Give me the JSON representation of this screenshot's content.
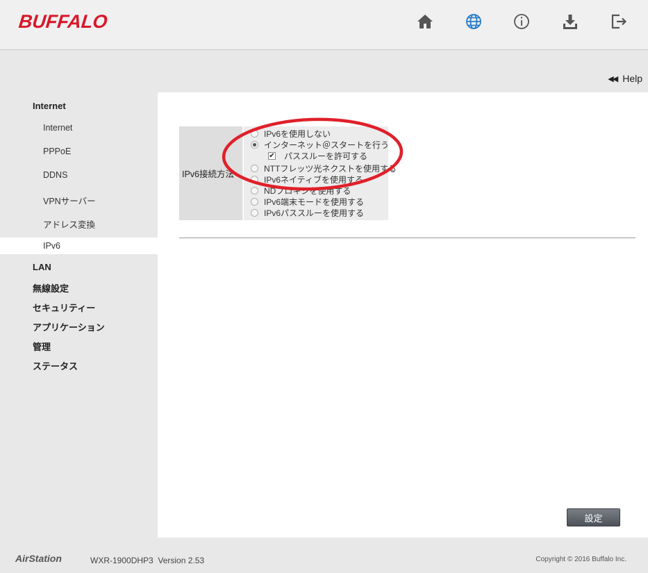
{
  "header": {
    "brand": "BUFFALO",
    "brand_color": "#d7182a",
    "icons": [
      "home-icon",
      "globe-icon",
      "info-icon",
      "download-icon",
      "logout-icon"
    ],
    "active_icon_color": "#2a7cc7"
  },
  "help": {
    "label": "Help"
  },
  "sidebar": {
    "internet": "Internet",
    "internet_sub": "Internet",
    "pppoe": "PPPoE",
    "ddns": "DDNS",
    "vpn": "VPNサーバー",
    "nat": "アドレス変換",
    "ipv6": "IPv6",
    "lan": "LAN",
    "wireless": "無線設定",
    "security": "セキュリティー",
    "application": "アプリケーション",
    "admin": "管理",
    "status": "ステータス"
  },
  "form": {
    "label": "IPv6接続方法",
    "options": [
      {
        "label": "IPv6を使用しない",
        "selected": false
      },
      {
        "label": "インターネット＠スタートを行う",
        "selected": true
      },
      {
        "label": "パススルーを許可する",
        "checked": true
      },
      {
        "label": "NTTフレッツ光ネクストを使用する",
        "selected": false
      },
      {
        "label": "IPv6ネイティブを使用する",
        "selected": false
      },
      {
        "label": "NDプロキシを使用する",
        "selected": false
      },
      {
        "label": "IPv6端末モードを使用する",
        "selected": false
      },
      {
        "label": "IPv6パススルーを使用する",
        "selected": false
      }
    ],
    "submit": "設定"
  },
  "annotation_color": "#e0202a",
  "footer": {
    "product": "AirStation",
    "model": "WXR-1900DHP3  Version 2.53",
    "copyright": "Copyright © 2016 Buffalo Inc."
  }
}
